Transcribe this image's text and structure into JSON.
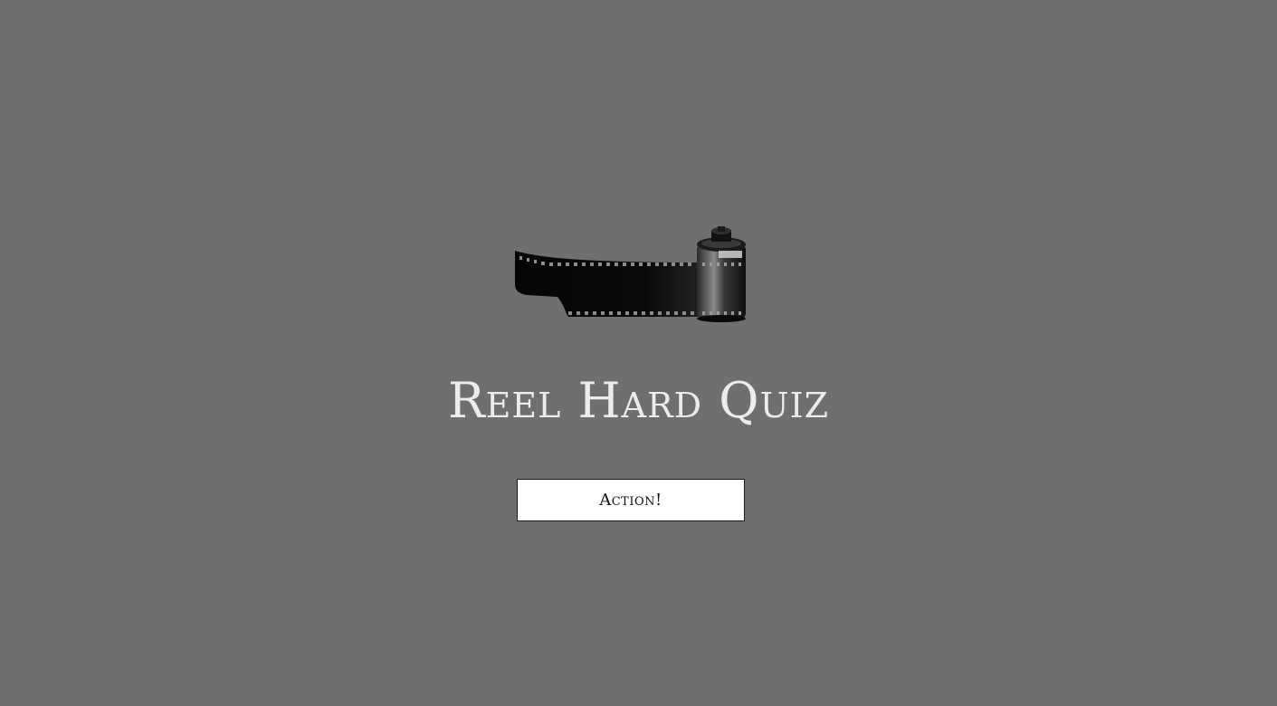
{
  "page": {
    "background_color": "#6f6f6f"
  },
  "logo": {
    "icon": "film-reel-icon"
  },
  "header": {
    "title": "Reel Hard Quiz"
  },
  "main": {
    "start_button_label": "Action!"
  },
  "colors": {
    "title": "#ececec",
    "button_bg": "#ffffff",
    "button_border": "#1a1a1a"
  }
}
